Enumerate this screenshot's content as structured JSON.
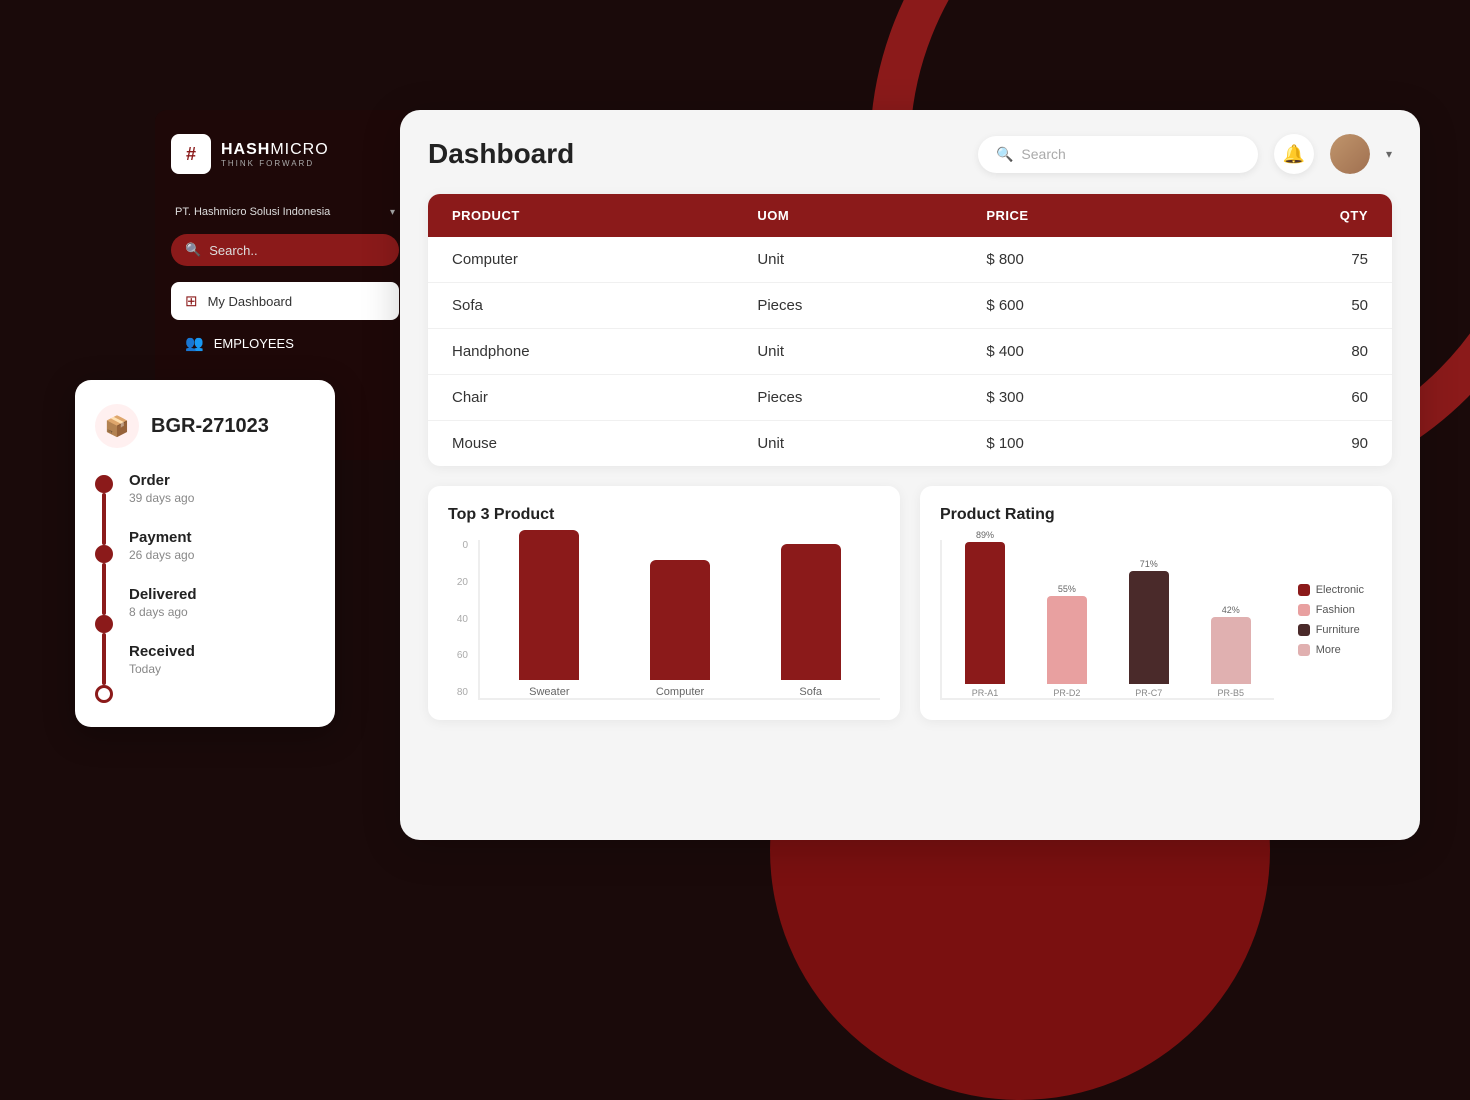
{
  "app": {
    "name": "HashMicro",
    "tagline": "THINK FORWARD",
    "logo_char": "#"
  },
  "sidebar": {
    "company": "PT. Hashmicro Solusi Indonesia",
    "search_placeholder": "Search..",
    "menu_items": [
      {
        "id": "dashboard",
        "label": "My Dashboard",
        "active": true
      },
      {
        "id": "employees",
        "label": "EMPLOYEES",
        "active": false
      }
    ]
  },
  "header": {
    "title": "Dashboard",
    "search_placeholder": "Search",
    "notification_icon": "🔔",
    "avatar_label": "User Avatar"
  },
  "table": {
    "columns": [
      "PRODUCT",
      "UoM",
      "PRICE",
      "QTY"
    ],
    "rows": [
      {
        "product": "Computer",
        "uom": "Unit",
        "price": "$ 800",
        "qty": "75"
      },
      {
        "product": "Sofa",
        "uom": "Pieces",
        "price": "$ 600",
        "qty": "50"
      },
      {
        "product": "Handphone",
        "uom": "Unit",
        "price": "$ 400",
        "qty": "80"
      },
      {
        "product": "Chair",
        "uom": "Pieces",
        "price": "$ 300",
        "qty": "60"
      },
      {
        "product": "Mouse",
        "uom": "Unit",
        "price": "$ 100",
        "qty": "90"
      }
    ]
  },
  "top3_chart": {
    "title": "Top 3 Product",
    "y_labels": [
      "80",
      "60",
      "40",
      "20",
      "0"
    ],
    "bars": [
      {
        "label": "Sweater",
        "value": 75,
        "color": "#8b1a1a"
      },
      {
        "label": "Computer",
        "value": 60,
        "color": "#8b1a1a"
      },
      {
        "label": "Sofa",
        "value": 68,
        "color": "#8b1a1a"
      }
    ]
  },
  "rating_chart": {
    "title": "Product Rating",
    "bars": [
      {
        "label": "PR-A1",
        "pct": "89%",
        "value": 89,
        "color": "#8b1a1a"
      },
      {
        "label": "PR-D2",
        "pct": "55%",
        "value": 55,
        "color": "#e8a0a0"
      },
      {
        "label": "PR-C7",
        "pct": "71%",
        "value": 71,
        "color": "#4a2a2a"
      },
      {
        "label": "PR-B5",
        "pct": "42%",
        "value": 42,
        "color": "#e0b0b0"
      }
    ],
    "legend": [
      {
        "label": "Electronic",
        "color": "#8b1a1a"
      },
      {
        "label": "Fashion",
        "color": "#e8a0a0"
      },
      {
        "label": "Furniture",
        "color": "#4a2a2a"
      },
      {
        "label": "More",
        "color": "#e0b0b0"
      }
    ]
  },
  "order_card": {
    "id": "BGR-271023",
    "steps": [
      {
        "label": "Order",
        "time": "39 days ago"
      },
      {
        "label": "Payment",
        "time": "26 days ago"
      },
      {
        "label": "Delivered",
        "time": "8 days ago"
      },
      {
        "label": "Received",
        "time": "Today"
      }
    ]
  }
}
